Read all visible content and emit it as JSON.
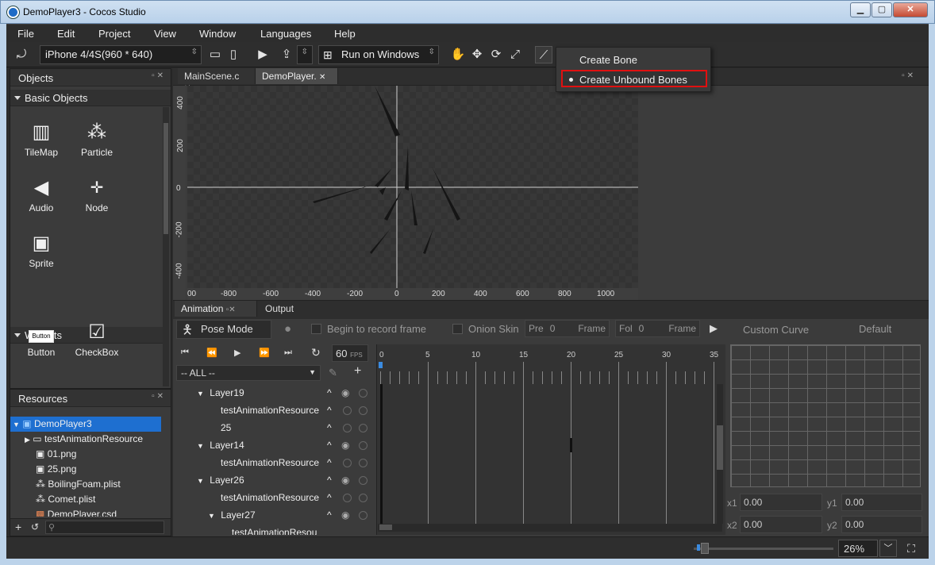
{
  "window": {
    "title": "DemoPlayer3 - Cocos Studio"
  },
  "menu": [
    "File",
    "Edit",
    "Project",
    "View",
    "Window",
    "Languages",
    "Help"
  ],
  "toolbar": {
    "device": "iPhone 4/4S(960 * 640)",
    "run_target": "Run on Windows"
  },
  "popup": {
    "create_bone": "Create Bone",
    "create_unbound": "Create Unbound Bones"
  },
  "objects": {
    "title": "Objects",
    "basic_title": "Basic Objects",
    "basic_items": [
      {
        "label": "TileMap",
        "icon": "map-icon"
      },
      {
        "label": "Particle",
        "icon": "particle-icon"
      },
      {
        "label": "Audio",
        "icon": "audio-icon"
      },
      {
        "label": "Node",
        "icon": "node-icon"
      },
      {
        "label": "Sprite",
        "icon": "image-icon"
      }
    ],
    "widgets_title": "Widgets",
    "widget_items": [
      {
        "label": "Button",
        "icon": "button-icon"
      },
      {
        "label": "CheckBox",
        "icon": "checkbox-icon"
      }
    ]
  },
  "resources": {
    "title": "Resources",
    "items": [
      "DemoPlayer3",
      "testAnimationResource",
      "01.png",
      "25.png",
      "BoilingFoam.plist",
      "Comet.plist",
      "DemoPlayer.csd"
    ]
  },
  "tabs": [
    "MainScene.c",
    "DemoPlayer."
  ],
  "canvas": {
    "x_ticks": [
      "00",
      "-800",
      "-600",
      "-400",
      "-200",
      "0",
      "200",
      "400",
      "600",
      "800",
      "1000"
    ],
    "y_ticks": [
      "400",
      "200",
      "0",
      "-200",
      "-400"
    ]
  },
  "anim": {
    "tab_animation": "Animation",
    "tab_output": "Output",
    "pose_mode": "Pose Mode",
    "record": "Begin to record frame",
    "onion": "Onion Skin",
    "pre": "Pre",
    "pre_val": "0",
    "frame": "Frame",
    "fol": "Fol",
    "fol_val": "0",
    "fps": "60",
    "fps_unit": "FPS",
    "filter": "-- ALL --",
    "frame_ticks": [
      "0",
      "5",
      "10",
      "15",
      "20",
      "25",
      "30",
      "35"
    ],
    "layers": [
      "Layer19",
      "testAnimationResource",
      "25",
      "Layer14",
      "testAnimationResource",
      "Layer26",
      "testAnimationResource",
      "Layer27",
      "testAnimationResou"
    ]
  },
  "curve": {
    "title": "Custom Curve",
    "preset": "Default",
    "x1_label": "x1",
    "x1": "0.00",
    "y1_label": "y1",
    "y1": "0.00",
    "x2_label": "x2",
    "x2": "0.00",
    "y2_label": "y2",
    "y2": "0.00"
  },
  "status": {
    "zoom": "26%"
  }
}
